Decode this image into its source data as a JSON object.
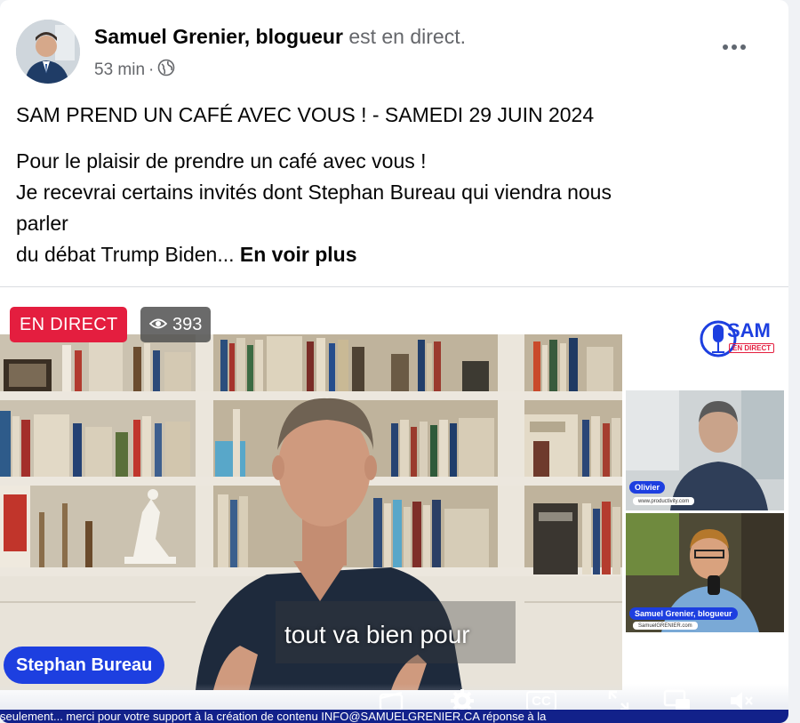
{
  "post": {
    "author": "Samuel Grenier, blogueur",
    "status": "est en direct.",
    "time": "53 min",
    "separator": "·",
    "title": "SAM PREND UN CAFÉ AVEC VOUS ! - SAMEDI 29 JUIN 2024",
    "body_lines": [
      "Pour le plaisir de prendre un café avec vous !",
      "Je recevrai certains invités dont Stephan Bureau qui viendra nous",
      "parler"
    ],
    "last_line": "du débat Trump Biden...",
    "see_more": "En voir plus"
  },
  "video": {
    "live_label": "EN DIRECT",
    "viewer_count": "393",
    "caption": "tout va bien pour",
    "speaker_name": "Stephan Bureau",
    "logo_text": "SAM",
    "logo_sub": "EN DIRECT",
    "guest1_name": "Olivier",
    "guest1_url": "www.productivity.com",
    "guest2_name": "Samuel Grenier, blogueur",
    "guest2_url": "SamuelGRENIER.com",
    "cc_label": "CC",
    "ticker": "seulement... merci pour votre support à la création de contenu INFO@SAMUELGRENIER.CA réponse à la"
  },
  "colors": {
    "live_red": "#e41e3f",
    "name_blue": "#1d3fe0",
    "ticker_blue": "#12218a"
  },
  "icons": [
    "more-options-icon",
    "globe-icon",
    "eye-icon",
    "mic-icon",
    "clip-icon",
    "settings-gear-icon",
    "closed-captions-icon",
    "fullscreen-icon",
    "picture-in-picture-icon",
    "volume-muted-icon"
  ]
}
